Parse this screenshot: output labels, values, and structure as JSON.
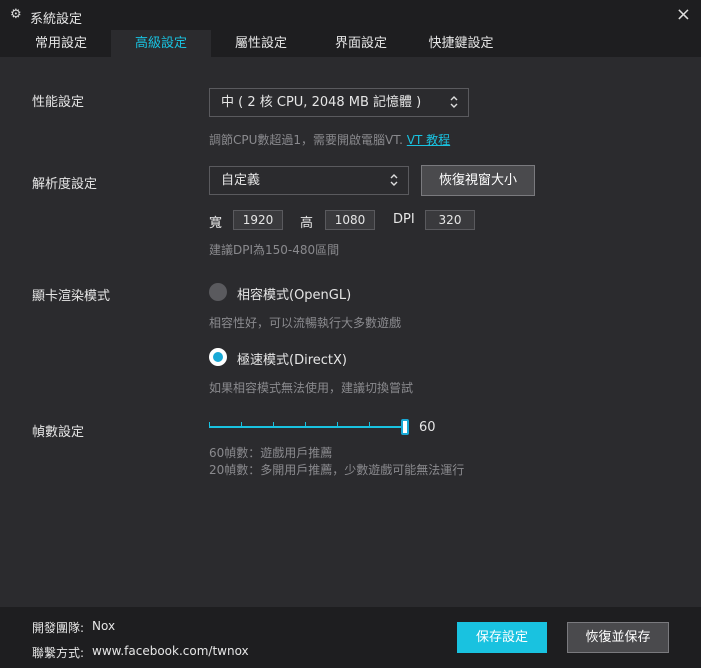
{
  "window": {
    "title": "系統設定"
  },
  "tabs": [
    {
      "label": "常用設定"
    },
    {
      "label": "高級設定"
    },
    {
      "label": "屬性設定"
    },
    {
      "label": "界面設定"
    },
    {
      "label": "快捷鍵設定"
    }
  ],
  "active_tab": 1,
  "performance": {
    "label": "性能設定",
    "selected": "中 ( 2 核 CPU, 2048 MB 記憶體 )",
    "hint_text": "調節CPU數超過1，需要開啟電腦VT.",
    "hint_link": "VT 教程"
  },
  "resolution": {
    "label": "解析度設定",
    "selected": "自定義",
    "restore_button": "恢復視窗大小",
    "width_label": "寬",
    "width": "1920",
    "height_label": "高",
    "height": "1080",
    "dpi_label": "DPI",
    "dpi": "320",
    "hint": "建議DPI為150-480區間"
  },
  "render": {
    "label": "顯卡渲染模式",
    "options": [
      {
        "label": "相容模式(OpenGL)",
        "desc": "相容性好，可以流暢執行大多數遊戲",
        "selected": false
      },
      {
        "label": "極速模式(DirectX)",
        "desc": "如果相容模式無法使用，建議切換嘗試",
        "selected": true
      }
    ]
  },
  "fps": {
    "label": "幀數設定",
    "value": "60",
    "value_fraction": 1.0,
    "notes": [
      "60幀數：遊戲用戶推薦",
      "20幀數：多開用戶推薦，少數遊戲可能無法運行"
    ]
  },
  "footer": {
    "dev_label": "開發團隊:",
    "dev_value": "Nox",
    "contact_label": "聯繫方式:",
    "contact_value": "www.facebook.com/twnox",
    "save_button": "保存設定",
    "restore_button": "恢復並保存"
  },
  "colors": {
    "accent": "#19c2e0",
    "background": "#2b2b2e",
    "titlebar": "#1e1e20"
  }
}
